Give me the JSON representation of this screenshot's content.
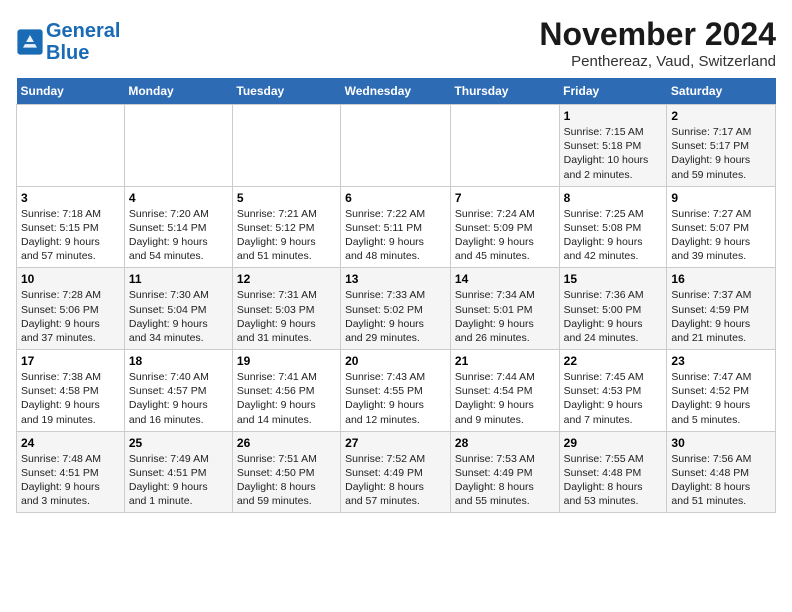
{
  "logo": {
    "line1": "General",
    "line2": "Blue"
  },
  "title": "November 2024",
  "subtitle": "Penthereaz, Vaud, Switzerland",
  "days_of_week": [
    "Sunday",
    "Monday",
    "Tuesday",
    "Wednesday",
    "Thursday",
    "Friday",
    "Saturday"
  ],
  "weeks": [
    [
      {
        "day": "",
        "info": ""
      },
      {
        "day": "",
        "info": ""
      },
      {
        "day": "",
        "info": ""
      },
      {
        "day": "",
        "info": ""
      },
      {
        "day": "",
        "info": ""
      },
      {
        "day": "1",
        "info": "Sunrise: 7:15 AM\nSunset: 5:18 PM\nDaylight: 10 hours\nand 2 minutes."
      },
      {
        "day": "2",
        "info": "Sunrise: 7:17 AM\nSunset: 5:17 PM\nDaylight: 9 hours\nand 59 minutes."
      }
    ],
    [
      {
        "day": "3",
        "info": "Sunrise: 7:18 AM\nSunset: 5:15 PM\nDaylight: 9 hours\nand 57 minutes."
      },
      {
        "day": "4",
        "info": "Sunrise: 7:20 AM\nSunset: 5:14 PM\nDaylight: 9 hours\nand 54 minutes."
      },
      {
        "day": "5",
        "info": "Sunrise: 7:21 AM\nSunset: 5:12 PM\nDaylight: 9 hours\nand 51 minutes."
      },
      {
        "day": "6",
        "info": "Sunrise: 7:22 AM\nSunset: 5:11 PM\nDaylight: 9 hours\nand 48 minutes."
      },
      {
        "day": "7",
        "info": "Sunrise: 7:24 AM\nSunset: 5:09 PM\nDaylight: 9 hours\nand 45 minutes."
      },
      {
        "day": "8",
        "info": "Sunrise: 7:25 AM\nSunset: 5:08 PM\nDaylight: 9 hours\nand 42 minutes."
      },
      {
        "day": "9",
        "info": "Sunrise: 7:27 AM\nSunset: 5:07 PM\nDaylight: 9 hours\nand 39 minutes."
      }
    ],
    [
      {
        "day": "10",
        "info": "Sunrise: 7:28 AM\nSunset: 5:06 PM\nDaylight: 9 hours\nand 37 minutes."
      },
      {
        "day": "11",
        "info": "Sunrise: 7:30 AM\nSunset: 5:04 PM\nDaylight: 9 hours\nand 34 minutes."
      },
      {
        "day": "12",
        "info": "Sunrise: 7:31 AM\nSunset: 5:03 PM\nDaylight: 9 hours\nand 31 minutes."
      },
      {
        "day": "13",
        "info": "Sunrise: 7:33 AM\nSunset: 5:02 PM\nDaylight: 9 hours\nand 29 minutes."
      },
      {
        "day": "14",
        "info": "Sunrise: 7:34 AM\nSunset: 5:01 PM\nDaylight: 9 hours\nand 26 minutes."
      },
      {
        "day": "15",
        "info": "Sunrise: 7:36 AM\nSunset: 5:00 PM\nDaylight: 9 hours\nand 24 minutes."
      },
      {
        "day": "16",
        "info": "Sunrise: 7:37 AM\nSunset: 4:59 PM\nDaylight: 9 hours\nand 21 minutes."
      }
    ],
    [
      {
        "day": "17",
        "info": "Sunrise: 7:38 AM\nSunset: 4:58 PM\nDaylight: 9 hours\nand 19 minutes."
      },
      {
        "day": "18",
        "info": "Sunrise: 7:40 AM\nSunset: 4:57 PM\nDaylight: 9 hours\nand 16 minutes."
      },
      {
        "day": "19",
        "info": "Sunrise: 7:41 AM\nSunset: 4:56 PM\nDaylight: 9 hours\nand 14 minutes."
      },
      {
        "day": "20",
        "info": "Sunrise: 7:43 AM\nSunset: 4:55 PM\nDaylight: 9 hours\nand 12 minutes."
      },
      {
        "day": "21",
        "info": "Sunrise: 7:44 AM\nSunset: 4:54 PM\nDaylight: 9 hours\nand 9 minutes."
      },
      {
        "day": "22",
        "info": "Sunrise: 7:45 AM\nSunset: 4:53 PM\nDaylight: 9 hours\nand 7 minutes."
      },
      {
        "day": "23",
        "info": "Sunrise: 7:47 AM\nSunset: 4:52 PM\nDaylight: 9 hours\nand 5 minutes."
      }
    ],
    [
      {
        "day": "24",
        "info": "Sunrise: 7:48 AM\nSunset: 4:51 PM\nDaylight: 9 hours\nand 3 minutes."
      },
      {
        "day": "25",
        "info": "Sunrise: 7:49 AM\nSunset: 4:51 PM\nDaylight: 9 hours\nand 1 minute."
      },
      {
        "day": "26",
        "info": "Sunrise: 7:51 AM\nSunset: 4:50 PM\nDaylight: 8 hours\nand 59 minutes."
      },
      {
        "day": "27",
        "info": "Sunrise: 7:52 AM\nSunset: 4:49 PM\nDaylight: 8 hours\nand 57 minutes."
      },
      {
        "day": "28",
        "info": "Sunrise: 7:53 AM\nSunset: 4:49 PM\nDaylight: 8 hours\nand 55 minutes."
      },
      {
        "day": "29",
        "info": "Sunrise: 7:55 AM\nSunset: 4:48 PM\nDaylight: 8 hours\nand 53 minutes."
      },
      {
        "day": "30",
        "info": "Sunrise: 7:56 AM\nSunset: 4:48 PM\nDaylight: 8 hours\nand 51 minutes."
      }
    ]
  ]
}
